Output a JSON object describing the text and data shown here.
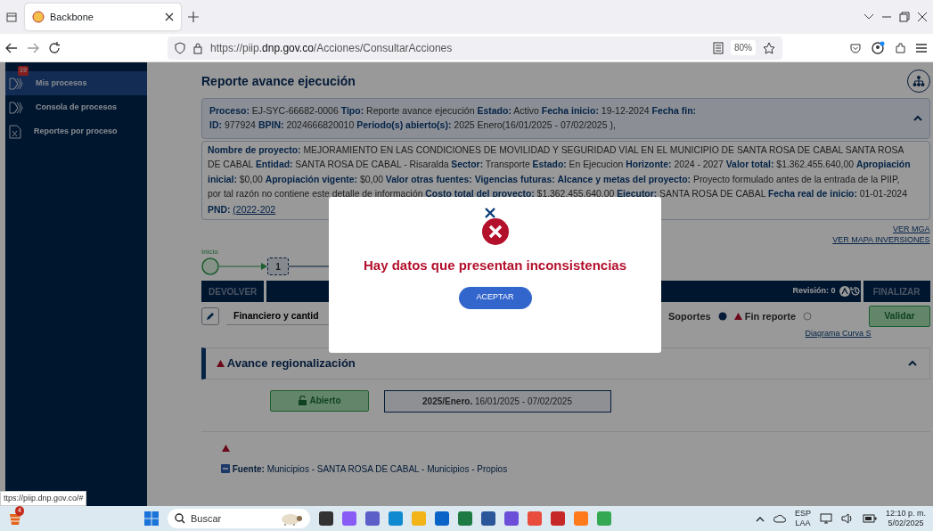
{
  "browser": {
    "tab_title": "Backbone",
    "url_scheme": "https://piip.",
    "url_host": "dnp.gov.co",
    "url_path": "/Acciones/ConsultarAcciones",
    "zoom": "80%"
  },
  "sidebar": {
    "badge": "19",
    "items": [
      {
        "label": "Mis procesos",
        "kind": "chevrons",
        "selected": true
      },
      {
        "label": "Consola de procesos",
        "kind": "chevrons",
        "selected": false
      },
      {
        "label": "Reportes por proceso",
        "kind": "spreadsheet",
        "selected": false
      }
    ]
  },
  "page_title": "Reporte avance ejecución",
  "process_header": {
    "expanded": true,
    "lines": [
      "**Proceso:** EJ-SYC-66682-0006 **Tipo:** Reporte avance ejecución **Estado:** Activo **Fecha inicio:** 19-12-2024 **Fecha fin:**",
      "**ID:** 977924 **BPIN:** 2024666820010 **Periodo(s) abierto(s):** 2025 Enero(16/01/2025 - 07/02/2025 ),"
    ]
  },
  "project_info": {
    "text": "**Nombre de proyecto:** MEJORAMIENTO EN LAS CONDICIONES DE MOVILIDAD Y SEGURIDAD VIAL EN EL MUNICIPIO DE SANTA ROSA DE CABAL SANTA ROSA DE CABAL **Entidad:** SANTA ROSA DE CABAL - Risaralda **Sector:** Transporte **Estado:** En Ejecucion **Horizonte:** 2024 - 2027 **Valor total:** $1.362.455.640,00 **Apropiación inicial:** $0,00 **Apropiación vigente:** $0,00 **Valor otras fuentes:** **Vigencias futuras:** **Alcance y metas del proyecto:** Proyecto formulado antes de la entrada de la PIIP, por tal razón no contiene este detalle de información **Costo total del proyecto:** $1.362.455.640,00 **Ejecutor:** SANTA ROSA DE CABAL **Fecha real de inicio:** 01-01-2024 **PND:**",
    "pnd_link": "(2022-202"
  },
  "links": [
    "VER MGA",
    "VER MAPA INVERSIONES"
  ],
  "flow": {
    "start_label": "Inicio",
    "step": "1"
  },
  "action_bar": {
    "return_button": "DEVOLVER",
    "revision": "Revisión: 0",
    "finish_button": "FINALIZAR"
  },
  "tabs_row": {
    "tab": "Financiero y cantid",
    "supports": "Soportes",
    "supports_done": true,
    "end_report": "Fin reporte",
    "end_report_done": false,
    "validate": "Validar",
    "curve_link": "Diagrama Curva S"
  },
  "section": {
    "title": "Avance regionalización",
    "expanded": true,
    "status": "Abierto",
    "period_bold": "2025/Enero.",
    "period": "16/01/2025 - 07/02/2025",
    "source": "**Fuente:** Municipios - SANTA ROSA DE CABAL - Municipios - Propios"
  },
  "modal": {
    "message": "Hay datos que presentan inconsistencias",
    "button": "ACEPTAR"
  },
  "status_url": "ttps://piip.dnp.gov.co/#",
  "taskbar": {
    "badge": "4",
    "search": "Buscar",
    "lang": "ESP",
    "layout": "LAA",
    "time": "12:10 p. m.",
    "date": "5/02/2025"
  }
}
